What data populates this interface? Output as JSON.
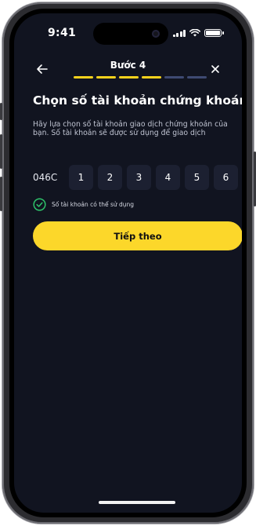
{
  "status_bar": {
    "time": "9:41"
  },
  "header": {
    "title": "Bước 4",
    "steps_total": 6,
    "steps_completed": 4
  },
  "main": {
    "heading": "Chọn số tài khoản chứng khoán",
    "description": "Hãy lựa chọn số tài khoản giao dịch chứng khoán của bạn. Số tài khoản sẽ được sử dụng để giao dịch",
    "account": {
      "prefix": "046C",
      "digits": [
        "1",
        "2",
        "3",
        "4",
        "5",
        "6"
      ]
    },
    "validation_message": "Số tài khoản có thể sử dụng",
    "next_button_label": "Tiếp theo"
  },
  "colors": {
    "accent": "#FCD72A",
    "background": "#111420",
    "success": "#2EC46B",
    "step_inactive": "#3E4A72"
  },
  "icons": {
    "back": "arrow-left-icon",
    "close": "close-icon",
    "validation": "check-circle-icon"
  }
}
